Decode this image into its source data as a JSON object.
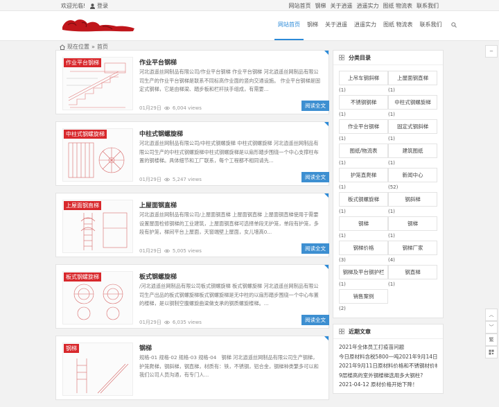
{
  "topbar": {
    "welcome": "欢迎光临!",
    "login": "登录",
    "links": [
      "网站首页",
      "钢梯",
      "关于逍遥",
      "逍遥实力",
      "图纸 物流表",
      "联系我们"
    ]
  },
  "nav": {
    "items": [
      "网站首页",
      "钢梯",
      "关于逍遥",
      "逍遥实力",
      "图纸 物流表",
      "联系我们"
    ],
    "active_index": 0
  },
  "breadcrumb": {
    "current": "现在位置",
    "sep": "»",
    "home": "首页"
  },
  "posts": [
    {
      "tag": "作业平台钢梯",
      "title": "作业平台钢梯",
      "excerpt": "河北逍遥丝网制品有限公司/作业平台钢梯 作业平台钢梯 河北逍遥丝网制品有限公司生产的作业平台钢梯是联系不同标高作业面的竖向交通设施。 作业平台钢梯是固定式钢梯，它是由梯梁、踏步板和栏杆扶手组成，有需要...",
      "date": "01月29日",
      "views": "6,004 views",
      "read": "阅读全文"
    },
    {
      "tag": "中柱式钢螺旋梯",
      "title": "中柱式钢螺旋梯",
      "excerpt": "河北逍遥丝网制品有限公司/中柱式钢螺旋梯 中柱式钢螺旋梯 河北逍遥丝网制品有限公司生产的中柱式钢螺旋梯中柱式钢螺旋梯是以扇形踏步围绕一个中心支撑柱布置的钢楼梯。具体细节和工厂联系，每个工程都不相同请先...",
      "date": "01月29日",
      "views": "5,247 views",
      "read": "阅读全文"
    },
    {
      "tag": "上屋面钢直梯",
      "title": "上屋面钢直梯",
      "excerpt": "河北逍遥丝网制品有限公司/上屋面钢直梯 上屋面钢直梯 上屋面钢直梯使用于需要设置屋面检修钢梯的工业建筑，上屋面钢直梯可选择单段无护笼，单段有护笼，多段有护笼，梯间平台上屋面，天窗端壁上屋面，女儿墙高0...",
      "date": "01月29日",
      "views": "5,005 views",
      "read": "阅读全文"
    },
    {
      "tag": "板式钢螺旋梯",
      "title": "板式钢螺旋梯",
      "excerpt": "/河北逍遥丝网制品有限公司板式钢螺旋梯 板式钢螺旋梯 河北逍遥丝网制品有限公司生产出品的板式钢螺旋梯板式钢螺旋梯是无中柱的以扇形踏步围绕一个中心布置的楼梯，是以钢制空腹螺旋曲梁做支承的钢质螺旋楼梯。...",
      "date": "01月29日",
      "views": "6,035 views",
      "read": "阅读全文"
    },
    {
      "tag": "钢梯",
      "title": "钢梯",
      "excerpt": "规格-01 规格-02 规格-03 规格-04　钢梯 河北逍遥丝网制品有限公司生产钢梯，护笼爬梯，钢斜梯，钢直梯，材质有：铁，不锈钢，铝合金，钢梯种类繁多可以和我们公司人员沟通，有专门人...",
      "date": "",
      "views": "",
      "read": ""
    }
  ],
  "sidebar": {
    "categories_title": "分类目录",
    "categories": [
      {
        "label": "上吊车钢斜梯",
        "count": "(1)"
      },
      {
        "label": "上屋面钢直梯",
        "count": "(1)"
      },
      {
        "label": "不锈钢钢梯",
        "count": "(1)"
      },
      {
        "label": "中柱式钢螺旋梯",
        "count": "(1)"
      },
      {
        "label": "作业平台钢梯",
        "count": "(1)"
      },
      {
        "label": "固定式钢斜梯",
        "count": "(1)"
      },
      {
        "label": "图纸/物流表",
        "count": "(1)"
      },
      {
        "label": "建筑图纸",
        "count": "(1)"
      },
      {
        "label": "护笼直爬梯",
        "count": "(1)"
      },
      {
        "label": "新闻中心",
        "count": "(52)"
      },
      {
        "label": "板式钢螺旋梯",
        "count": "(1)"
      },
      {
        "label": "钢斜梯",
        "count": "(1)"
      },
      {
        "label": "钢梯",
        "count": "(1)"
      },
      {
        "label": "钢梯",
        "count": "(1)"
      },
      {
        "label": "钢梯价格",
        "count": "(3)"
      },
      {
        "label": "钢梯厂家",
        "count": "(4)"
      },
      {
        "label": "钢梯及平台钢护栏",
        "count": "(1)"
      },
      {
        "label": "钢直梯",
        "count": "(1)"
      },
      {
        "label": "销售案例",
        "count": "(2)"
      }
    ],
    "recent_title": "近期文章",
    "recent": [
      "2021年全体员工打疫苗问题",
      "今日原材料含税5800一吨2021年9月14日报价",
      "2021年9月11日原材料价格和不锈钢材价格",
      "9层楼高的室外钢楼梯选用多大钢柱?",
      "2021-04-12 原材价格开始下降！"
    ]
  },
  "tools": [
    "−",
    "繁",
    "︿",
    "﹀"
  ],
  "colors": {
    "accent": "#2b8ad8",
    "tag_red": "#d8282c",
    "read_btn": "#3d8fd1"
  }
}
